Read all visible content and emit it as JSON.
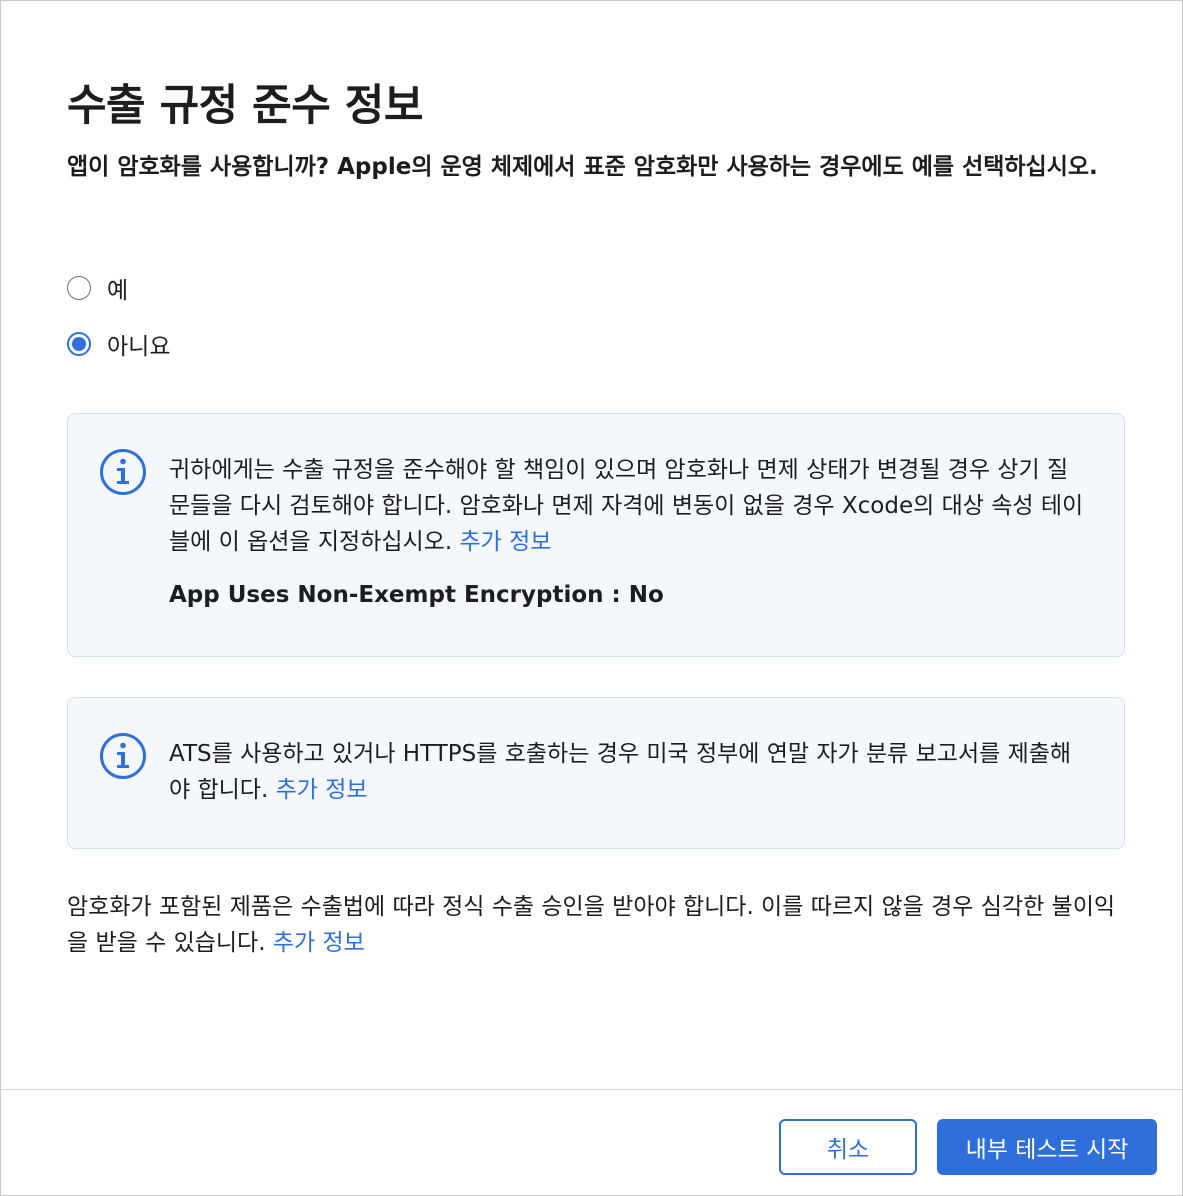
{
  "dialog": {
    "title": "수출 규정 준수 정보",
    "question": "앱이 암호화를 사용합니까? Apple의 운영 체제에서 표준 암호화만 사용하는 경우에도 예를 선택하십시오."
  },
  "options": [
    {
      "label": "예",
      "checked": false
    },
    {
      "label": "아니요",
      "checked": true
    }
  ],
  "info_box_1": {
    "text": "귀하에게는 수출 규정을 준수해야 할 책임이 있으며 암호화나 면제 상태가 변경될 경우 상기 질문들을 다시 검토해야 합니다. 암호화나 면제 자격에 변동이 없을 경우 Xcode의 대상 속성 테이블에 이 옵션을 지정하십시오. ",
    "link": "추가 정보",
    "encryption_line": "App Uses Non-Exempt Encryption : No",
    "icon": "info-circle-icon"
  },
  "info_box_2": {
    "text": "ATS를 사용하고 있거나 HTTPS를 호출하는 경우 미국 정부에 연말 자가 분류 보고서를 제출해야 합니다. ",
    "link": "추가 정보",
    "icon": "info-circle-icon"
  },
  "notice": {
    "text": "암호화가 포함된 제품은 수출법에 따라 정식 수출 승인을 받아야 합니다. 이를 따르지 않을 경우 심각한 불이익을 받을 수 있습니다. ",
    "link": "추가 정보"
  },
  "footer": {
    "cancel_label": "취소",
    "start_label": "내부 테스트 시작"
  },
  "colors": {
    "accent": "#2f6fdb",
    "info_bg": "#f4f8fd",
    "info_border": "#cfe0f3"
  }
}
